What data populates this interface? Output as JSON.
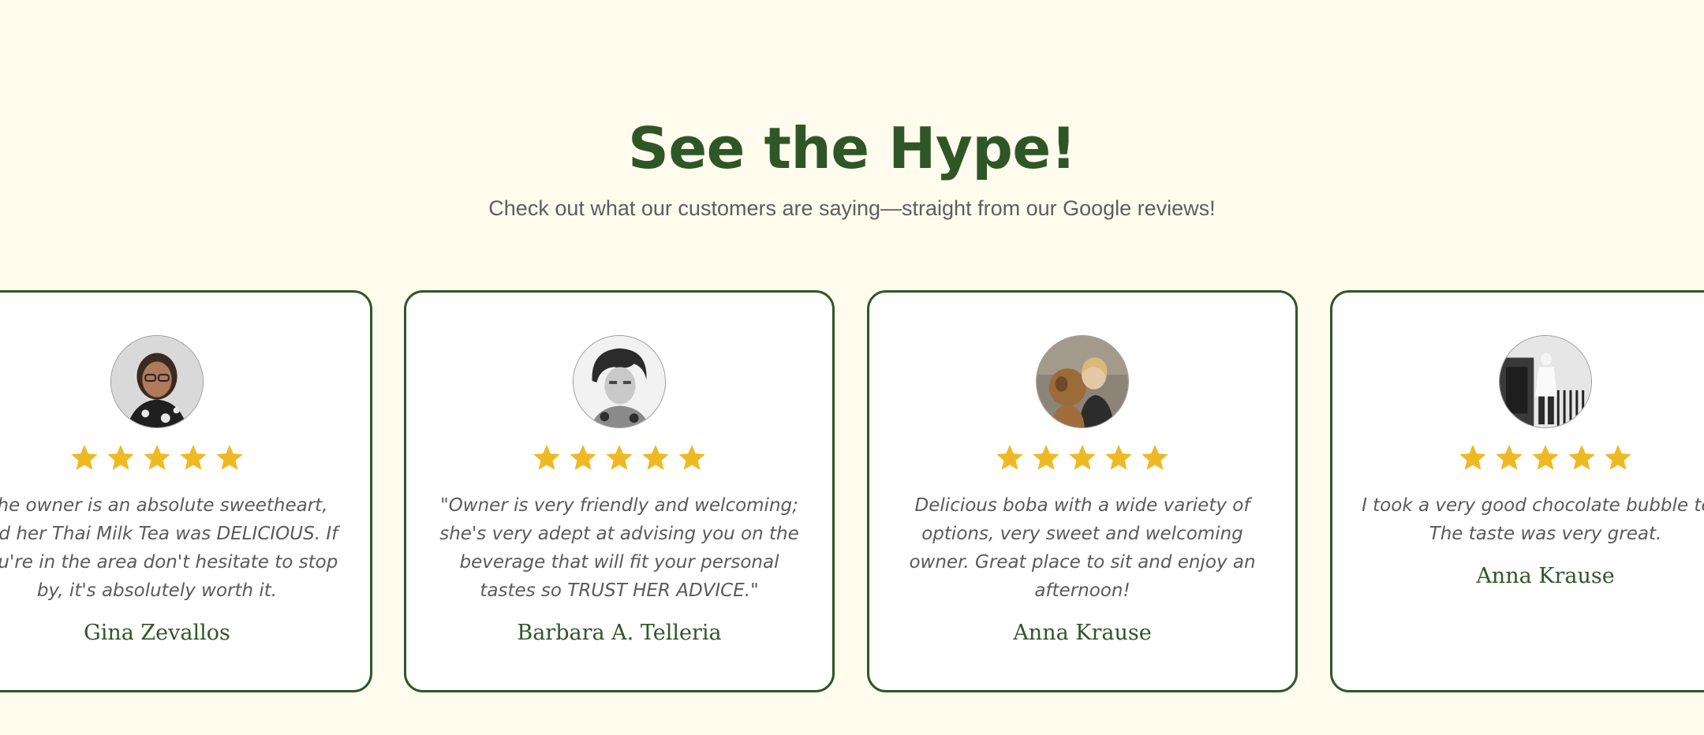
{
  "section": {
    "title": "See the Hype!",
    "subtitle": "Check out what our customers are saying—straight from our Google reviews!"
  },
  "colors": {
    "background": "#fffcee",
    "brand_green": "#2f5627",
    "star_gold": "#f0b923",
    "card_bg": "#ffffff",
    "body_text": "#5a5a5a"
  },
  "reviews": [
    {
      "author": "Gina Zevallos",
      "rating": 5,
      "quote": "The owner is an absolute sweetheart, and her Thai Milk Tea was DELICIOUS. If you're in the area don't hesitate to stop by, it's absolutely worth it.",
      "avatar_icon": "reviewer-photo-icon"
    },
    {
      "author": "Barbara A. Telleria",
      "rating": 5,
      "quote": "\"Owner is very friendly and welcoming; she's very adept at advising you on the beverage that will fit your personal tastes so TRUST HER ADVICE.\"",
      "avatar_icon": "reviewer-photo-icon"
    },
    {
      "author": "Anna Krause",
      "rating": 5,
      "quote": "Delicious boba with a wide variety of options, very sweet and welcoming owner. Great place to sit and enjoy an afternoon!",
      "avatar_icon": "reviewer-photo-icon"
    },
    {
      "author": "Anna Krause",
      "rating": 5,
      "quote": "I took a very good chocolate bubble tea. The taste was very great.",
      "avatar_icon": "reviewer-photo-icon"
    }
  ]
}
